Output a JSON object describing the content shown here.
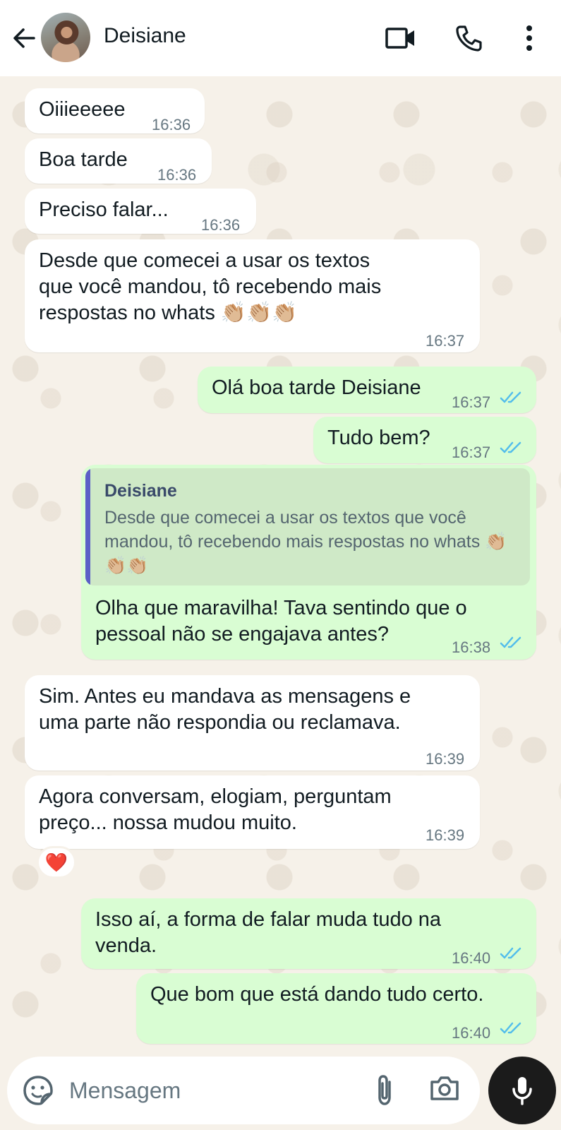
{
  "header": {
    "contact_name": "Deisiane",
    "icons": [
      "arrow-left-icon",
      "avatar",
      "video-camera-icon",
      "phone-icon",
      "more-vert-icon"
    ]
  },
  "messages": [
    {
      "direction": "in",
      "text": "Oiiieeeee",
      "time": "16:36"
    },
    {
      "direction": "in",
      "text": "Boa tarde",
      "time": "16:36"
    },
    {
      "direction": "in",
      "text": "Preciso falar...",
      "time": "16:36"
    },
    {
      "direction": "in",
      "text": "Desde que comecei a usar os textos\nque você mandou, tô recebendo mais\nrespostas no whats 👏🏼👏🏼👏🏼",
      "time": "16:37"
    },
    {
      "direction": "out",
      "text": "Olá boa tarde Deisiane",
      "time": "16:37",
      "status": "read"
    },
    {
      "direction": "out",
      "text": "Tudo bem?",
      "time": "16:37",
      "status": "read"
    },
    {
      "direction": "out",
      "text": "Olha que maravilha! Tava sentindo que o\npessoal não se engajava antes?",
      "time": "16:38",
      "status": "read",
      "reply_to": {
        "author": "Deisiane",
        "text": "Desde que comecei a usar os textos que você mandou, tô recebendo mais respostas no whats 👏🏼👏🏼👏🏼"
      }
    },
    {
      "direction": "in",
      "text": "Sim. Antes eu mandava as mensagens e\numa parte não respondia ou reclamava.",
      "time": "16:39"
    },
    {
      "direction": "in",
      "text": "Agora conversam, elogiam, perguntam\npreço... nossa mudou muito.",
      "time": "16:39",
      "reaction": "❤️"
    },
    {
      "direction": "out",
      "text": "Isso aí, a forma de falar muda tudo na\nvenda.",
      "time": "16:40",
      "status": "read"
    },
    {
      "direction": "out",
      "text": "Que bom que está dando tudo certo.",
      "time": "16:40",
      "status": "read"
    }
  ],
  "input": {
    "placeholder": "Mensagem",
    "value": ""
  },
  "colors": {
    "incoming_bubble": "#ffffff",
    "outgoing_bubble": "#d9fdd3",
    "read_ticks": "#53bdeb",
    "chat_background": "#f6f1e9",
    "reply_bar": "#5b5fc7",
    "mic_button": "#1b1b1b"
  }
}
